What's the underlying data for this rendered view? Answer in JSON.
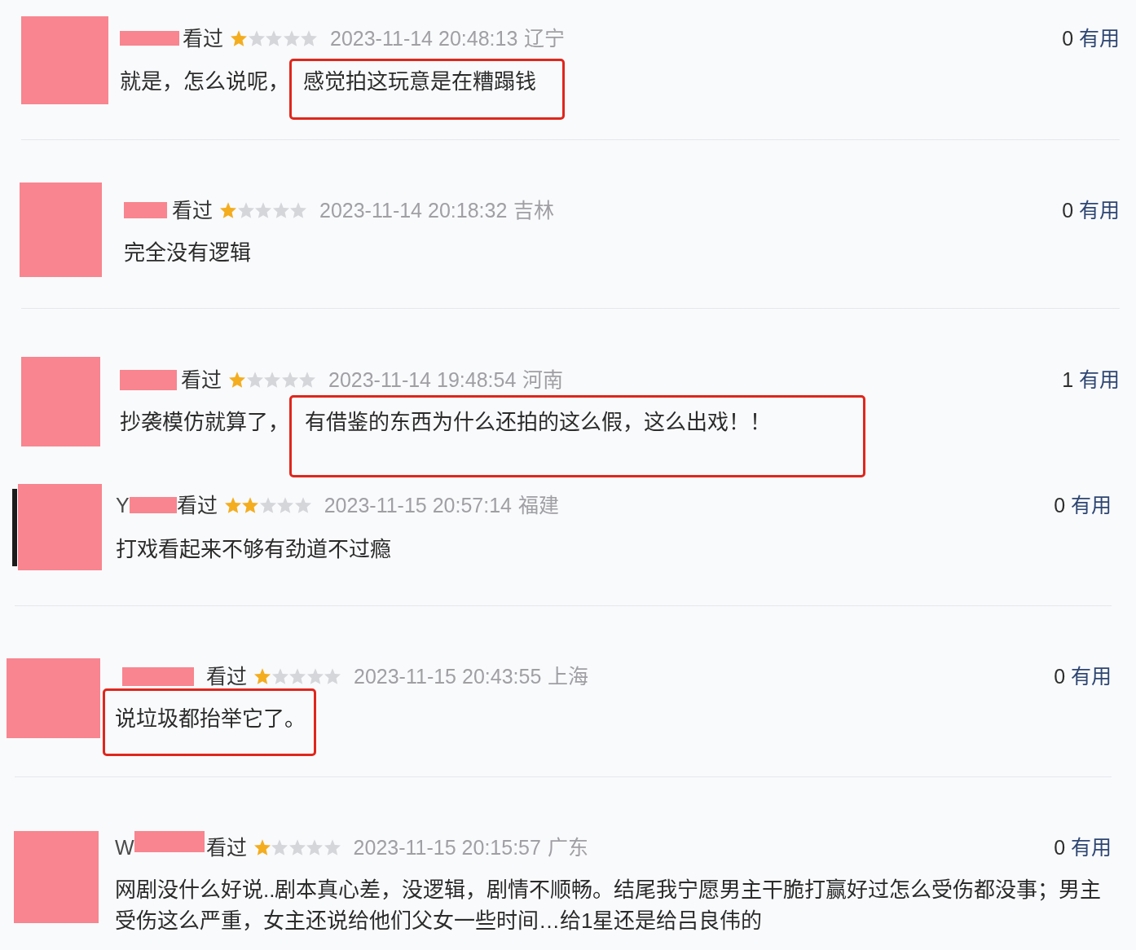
{
  "reviews": [
    {
      "status": "看过",
      "stars": 1,
      "date": "2023-11-14 20:48:13",
      "location": "辽宁",
      "comment": [
        {
          "text": "就是，怎么说呢，",
          "highlighted": false
        },
        {
          "text": "感觉拍这玩意是在糟蹋钱",
          "highlighted": true
        }
      ],
      "useful_count": "0",
      "useful_label": "有用",
      "divider": true,
      "edge_mark": false
    },
    {
      "status": "看过",
      "stars": 1,
      "date": "2023-11-14 20:18:32",
      "location": "吉林",
      "comment": [
        {
          "text": "完全没有逻辑",
          "highlighted": false
        }
      ],
      "useful_count": "0",
      "useful_label": "有用",
      "divider": true,
      "edge_mark": false
    },
    {
      "status": "看过",
      "stars": 1,
      "date": "2023-11-14 19:48:54",
      "location": "河南",
      "comment": [
        {
          "text": "抄袭模仿就算了，",
          "highlighted": false
        },
        {
          "text": "有借鉴的东西为什么还拍的这么假，这么出戏！！",
          "highlighted": true
        }
      ],
      "useful_count": "1",
      "useful_label": "有用",
      "divider": false,
      "edge_mark": false
    },
    {
      "name_fragment": "Y",
      "status": "看过",
      "stars": 2,
      "date": "2023-11-15 20:57:14",
      "location": "福建",
      "comment": [
        {
          "text": "打戏看起来不够有劲道不过瘾",
          "highlighted": false
        }
      ],
      "useful_count": "0",
      "useful_label": "有用",
      "divider": true,
      "edge_mark": true
    },
    {
      "status": "看过",
      "stars": 1,
      "date": "2023-11-15 20:43:55",
      "location": "上海",
      "comment": [
        {
          "text": "说垃圾都抬举它了。",
          "highlighted": true
        }
      ],
      "useful_count": "0",
      "useful_label": "有用",
      "divider": true,
      "edge_mark": false
    },
    {
      "name_fragment": "W",
      "status": "看过",
      "stars": 1,
      "date": "2023-11-15 20:15:57",
      "location": "广东",
      "comment": [
        {
          "text": "网剧没什么好说..剧本真心差，没逻辑，剧情不顺畅。结尾我宁愿男主干脆打赢好过怎么受伤都没事；男主受伤这么严重，女主还说给他们父女一些时间…给1星还是给吕良伟的",
          "highlighted": false
        }
      ],
      "useful_count": "0",
      "useful_label": "有用",
      "divider": false,
      "edge_mark": false
    }
  ]
}
